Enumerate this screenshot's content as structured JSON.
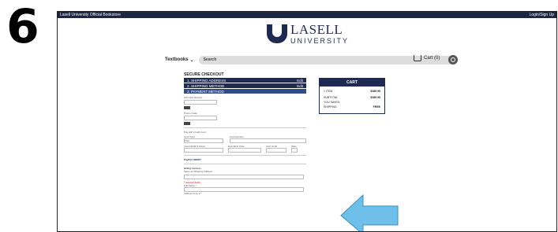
{
  "step_number": "6",
  "topbar": {
    "store_name": "Lasell University Official Bookstore",
    "login": "Login/Sign Up"
  },
  "logo": {
    "name": "LASELL",
    "sub": "UNIVERSITY"
  },
  "nav": {
    "textbooks": "Textbooks",
    "search_label": "Search",
    "cart": "Cart (0)"
  },
  "checkout": {
    "title": "SECURE CHECKOUT",
    "steps": [
      {
        "label": "1. SHIPPING ADDRESS",
        "action": "Edit"
      },
      {
        "label": "2. SHIPPING METHOD",
        "action": "Edit"
      },
      {
        "label": "3. PAYMENT METHOD",
        "action": ""
      }
    ],
    "gift_card_label": "Gift Card Number",
    "promo_label": "Promo Code",
    "apply": "Apply",
    "pay_credit": "Pay with Credit Card",
    "card_type_label": "Card Type",
    "card_type_value": "Visa",
    "card_number_label": "Card Number",
    "cardholder_label": "Card Holder's Name",
    "expiration_label": "Expiration Date",
    "cvv_label": "CVV Code",
    "save_label": "Save",
    "paypal": "PayPal CREDIT",
    "billing_title": "Billing Address",
    "same_as_shipping": "Same as Shipping Address",
    "required_note": "* required fields",
    "full_name_label": "Full Name *",
    "address_label": "Address Line 1 *"
  },
  "cart": {
    "title": "CART",
    "rows": [
      {
        "label": "1 ITEM",
        "value": "$189.95"
      },
      {
        "label": "SUBTOTAL",
        "value": "$189.95"
      },
      {
        "label": "YOU SAVED:",
        "value": ""
      },
      {
        "label": "SHIPPING",
        "value": "FREE"
      }
    ]
  },
  "colors": {
    "navy": "#1e2a52",
    "arrow": "#6ec0ea"
  }
}
